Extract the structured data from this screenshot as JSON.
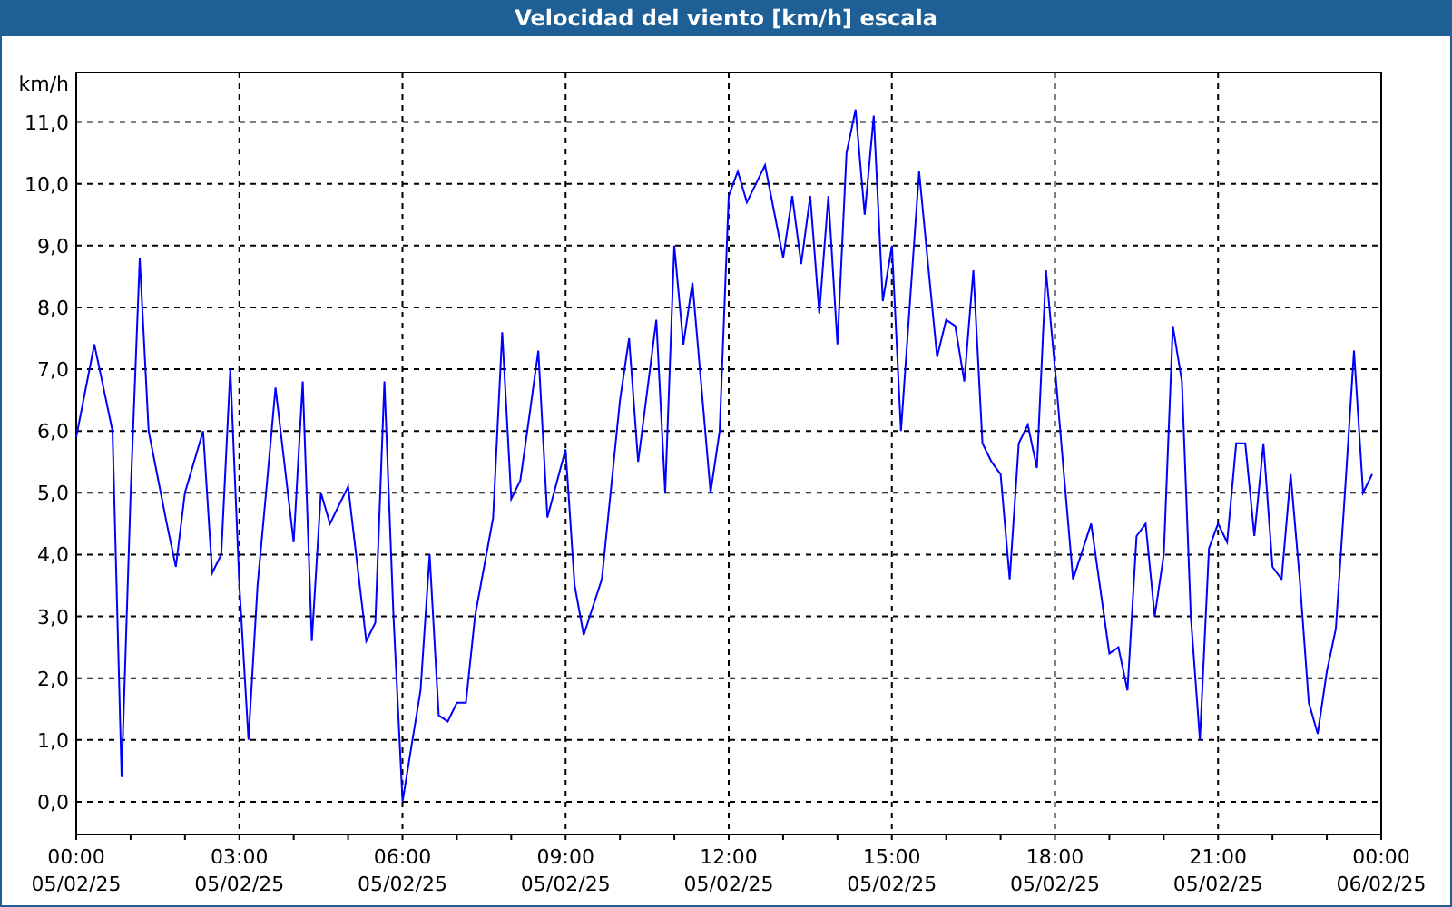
{
  "window": {
    "title": "Velocidad del viento [km/h] escala"
  },
  "chart": {
    "chart_data": {
      "type": "line",
      "ylabel": "km/h",
      "ylim": [
        -0.53,
        11.8
      ],
      "grid": true,
      "yticks": [
        {
          "value": 0,
          "label": "0,0"
        },
        {
          "value": 1,
          "label": "1,0"
        },
        {
          "value": 2,
          "label": "2,0"
        },
        {
          "value": 3,
          "label": "3,0"
        },
        {
          "value": 4,
          "label": "4,0"
        },
        {
          "value": 5,
          "label": "5,0"
        },
        {
          "value": 6,
          "label": "6,0"
        },
        {
          "value": 7,
          "label": "7,0"
        },
        {
          "value": 8,
          "label": "8,0"
        },
        {
          "value": 9,
          "label": "9,0"
        },
        {
          "value": 10,
          "label": "10,0"
        },
        {
          "value": 11,
          "label": "11,0"
        }
      ],
      "categories": [
        "00:00\n05/02/25",
        null,
        null,
        null,
        null,
        null,
        null,
        null,
        null,
        null,
        null,
        null,
        null,
        null,
        null,
        null,
        null,
        null,
        "03:00\n05/02/25",
        null,
        null,
        null,
        null,
        null,
        null,
        null,
        null,
        null,
        null,
        null,
        null,
        null,
        null,
        null,
        null,
        null,
        "06:00\n05/02/25",
        null,
        null,
        null,
        null,
        null,
        null,
        null,
        null,
        null,
        null,
        null,
        null,
        null,
        null,
        null,
        null,
        null,
        "09:00\n05/02/25",
        null,
        null,
        null,
        null,
        null,
        null,
        null,
        null,
        null,
        null,
        null,
        null,
        null,
        null,
        null,
        null,
        null,
        "12:00\n05/02/25",
        null,
        null,
        null,
        null,
        null,
        null,
        null,
        null,
        null,
        null,
        null,
        null,
        null,
        null,
        null,
        null,
        null,
        "15:00\n05/02/25",
        null,
        null,
        null,
        null,
        null,
        null,
        null,
        null,
        null,
        null,
        null,
        null,
        null,
        null,
        null,
        null,
        null,
        "18:00\n05/02/25",
        null,
        null,
        null,
        null,
        null,
        null,
        null,
        null,
        null,
        null,
        null,
        null,
        null,
        null,
        null,
        null,
        null,
        "21:00\n05/02/25",
        null,
        null,
        null,
        null,
        null,
        null,
        null,
        null,
        null,
        null,
        null,
        null,
        null,
        null,
        null,
        null,
        null,
        "00:00\n06/02/25"
      ],
      "series": [
        {
          "color": "#0000ff",
          "values": [
            5.9,
            6.65,
            7.4,
            6.7,
            6.0,
            0.4,
            5.0,
            8.8,
            6.0,
            5.25,
            4.5,
            3.8,
            5.0,
            5.5,
            6.0,
            3.7,
            4.0,
            7.0,
            3.5,
            1.0,
            3.5,
            5.1,
            6.7,
            5.45,
            4.2,
            6.8,
            2.6,
            5.0,
            4.5,
            4.8,
            5.1,
            3.85,
            2.6,
            2.9,
            6.8,
            3.0,
            0.0,
            0.9,
            1.8,
            4.0,
            1.4,
            1.3,
            1.6,
            1.6,
            3.0,
            3.8,
            4.6,
            7.6,
            4.9,
            5.2,
            6.25,
            7.3,
            4.6,
            5.15,
            5.7,
            3.5,
            2.7,
            3.15,
            3.6,
            5.05,
            6.5,
            7.5,
            5.5,
            6.65,
            7.8,
            5.0,
            9.0,
            7.4,
            8.4,
            6.7,
            5.0,
            6.0,
            9.8,
            10.2,
            9.7,
            10.0,
            10.3,
            9.55,
            8.8,
            9.8,
            8.7,
            9.8,
            7.9,
            9.8,
            7.4,
            10.5,
            11.2,
            9.5,
            11.1,
            8.1,
            9.0,
            6.0,
            8.1,
            10.2,
            8.7,
            7.2,
            7.8,
            7.7,
            6.8,
            8.6,
            5.8,
            5.5,
            5.3,
            3.6,
            5.8,
            6.1,
            5.4,
            8.6,
            7.0,
            5.3,
            3.6,
            4.05,
            4.5,
            3.45,
            2.4,
            2.5,
            1.8,
            4.3,
            4.5,
            3.0,
            4.0,
            7.7,
            6.8,
            3.0,
            1.0,
            4.1,
            4.5,
            4.2,
            5.8,
            5.8,
            4.3,
            5.8,
            3.8,
            3.6,
            5.3,
            3.6,
            1.6,
            1.1,
            2.1,
            2.8,
            5.0,
            7.3,
            5.0,
            5.3,
            null
          ]
        }
      ]
    }
  }
}
